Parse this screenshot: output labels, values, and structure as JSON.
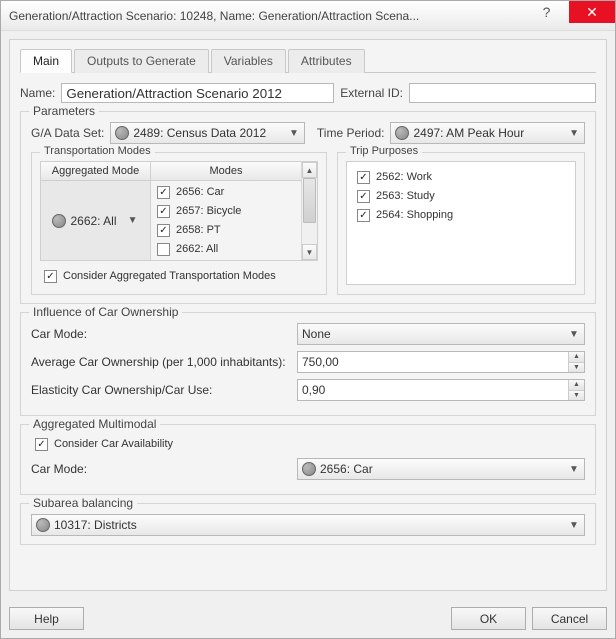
{
  "titlebar": "Generation/Attraction Scenario: 10248, Name: Generation/Attraction Scena...",
  "tabs": {
    "main": "Main",
    "outputs": "Outputs to Generate",
    "variables": "Variables",
    "attributes": "Attributes"
  },
  "nameRow": {
    "nameLabel": "Name:",
    "nameValue": "Generation/Attraction Scenario 2012",
    "extLabel": "External ID:",
    "extValue": ""
  },
  "parameters": {
    "legend": "Parameters",
    "gaLabel": "G/A Data Set:",
    "gaValue": "2489: Census Data 2012",
    "tpLabel": "Time Period:",
    "tpValue": "2497: AM Peak Hour",
    "transModes": {
      "legend": "Transportation Modes",
      "aggHead": "Aggregated Mode",
      "modesHead": "Modes",
      "aggValue": "2662: All",
      "modes": [
        {
          "label": "2656: Car",
          "checked": true
        },
        {
          "label": "2657: Bicycle",
          "checked": true
        },
        {
          "label": "2658: PT",
          "checked": true
        },
        {
          "label": "2662: All",
          "checked": false
        }
      ],
      "considerAgg": "Consider Aggregated Transportation Modes"
    },
    "tripPurposes": {
      "legend": "Trip Purposes",
      "items": [
        {
          "label": "2562: Work",
          "checked": true
        },
        {
          "label": "2563: Study",
          "checked": true
        },
        {
          "label": "2564: Shopping",
          "checked": true
        }
      ]
    }
  },
  "influence": {
    "legend": "Influence of Car Ownership",
    "carModeLabel": "Car Mode:",
    "carModeValue": "None",
    "avgLabel": "Average Car Ownership (per 1,000 inhabitants):",
    "avgValue": "750,00",
    "elasLabel": "Elasticity Car Ownership/Car Use:",
    "elasValue": "0,90"
  },
  "aggMulti": {
    "legend": "Aggregated Multimodal",
    "considerAvail": "Consider Car Availability",
    "carModeLabel": "Car Mode:",
    "carModeValue": "2656: Car"
  },
  "subarea": {
    "legend": "Subarea balancing",
    "value": "10317: Districts"
  },
  "buttons": {
    "help": "Help",
    "ok": "OK",
    "cancel": "Cancel"
  }
}
